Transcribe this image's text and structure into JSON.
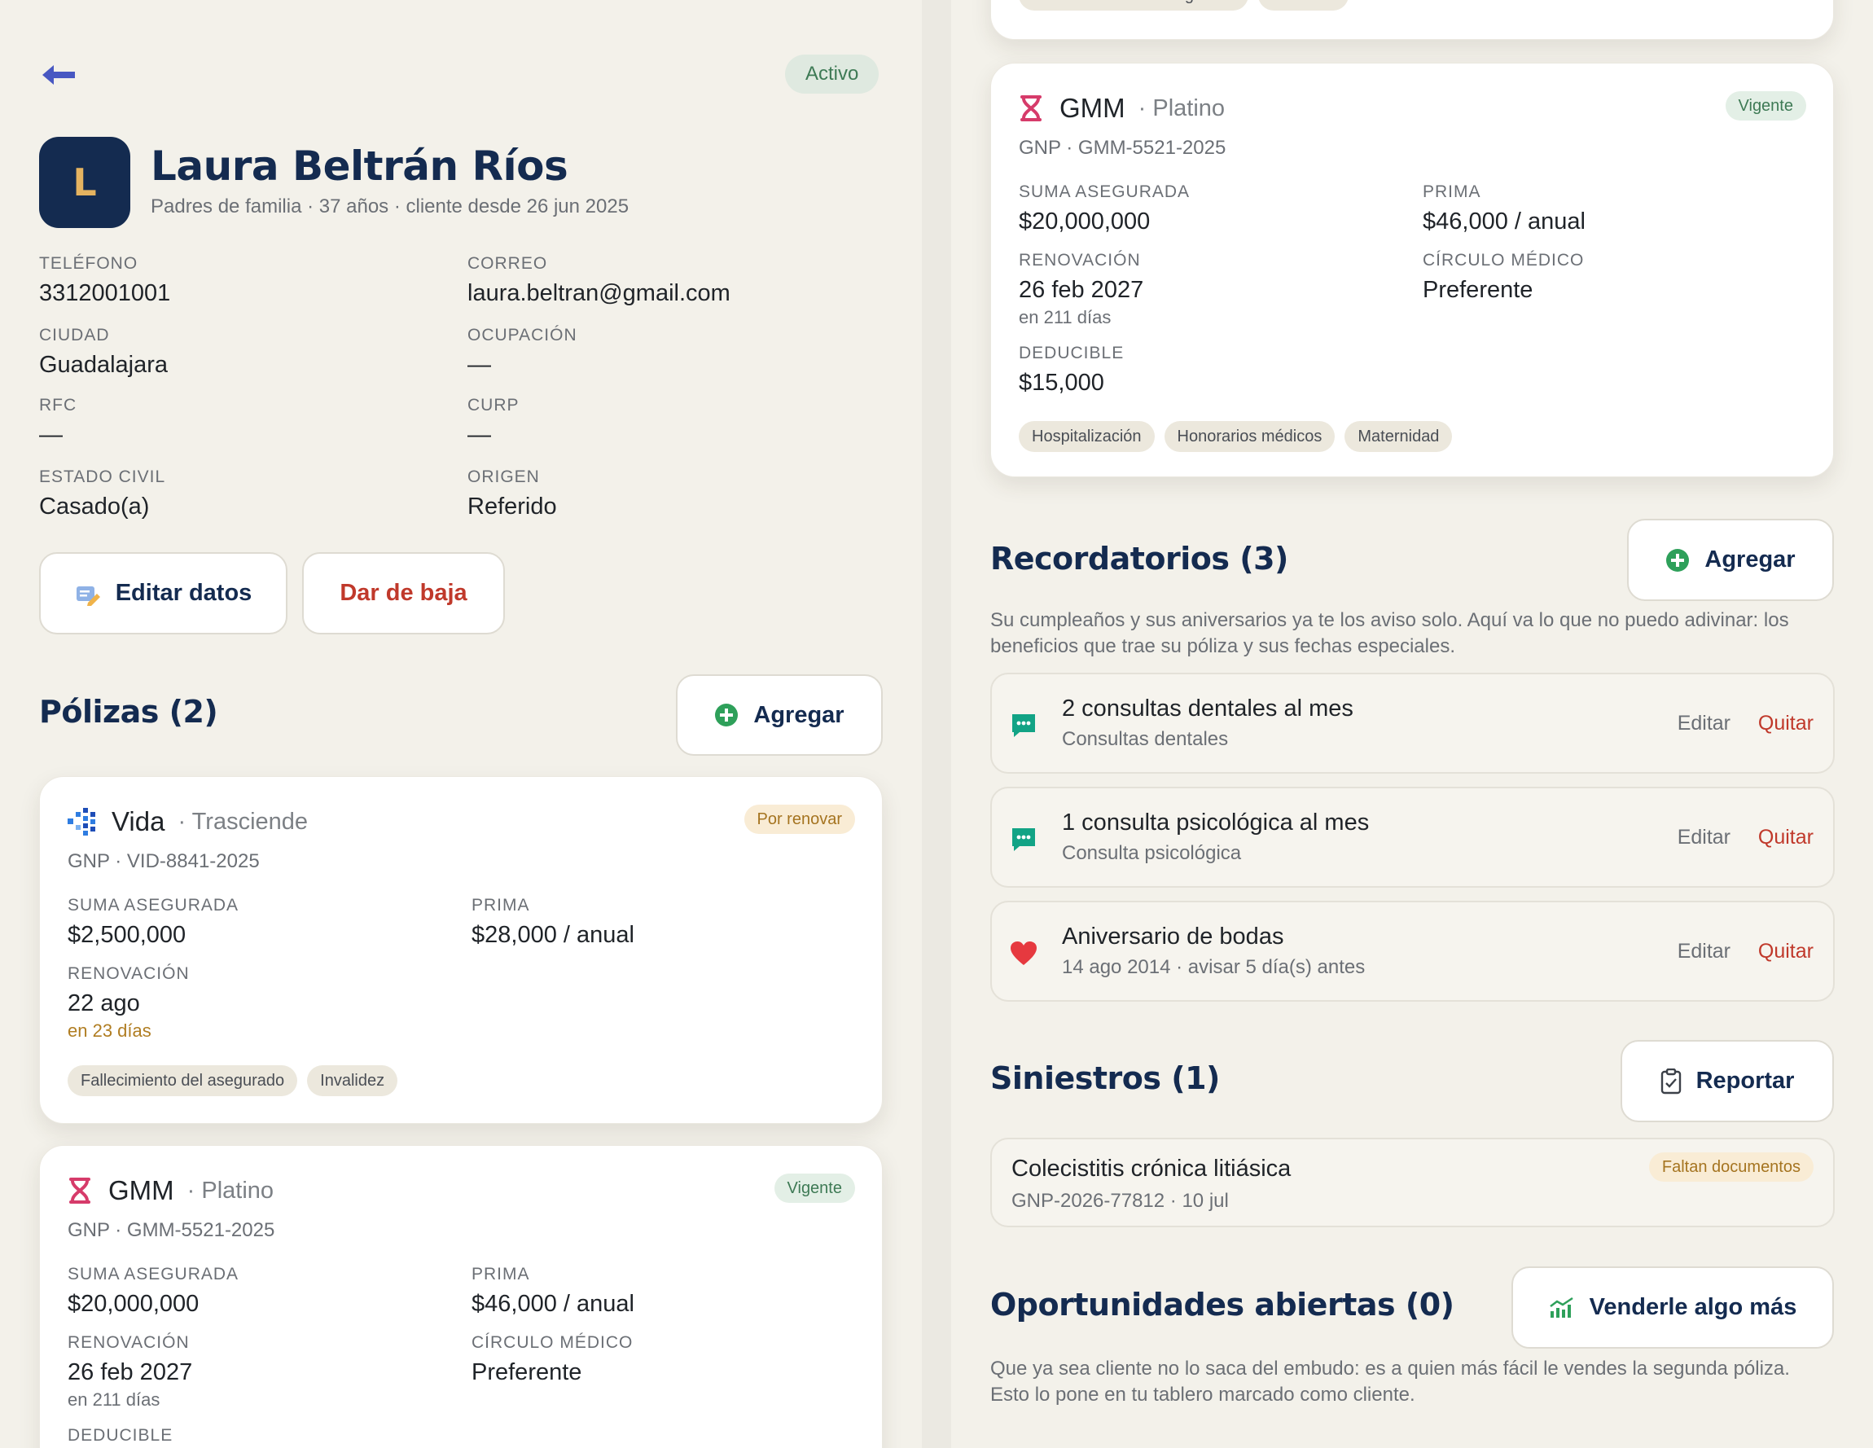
{
  "header": {
    "back_icon": "arrow-left-icon",
    "status": "Activo"
  },
  "client": {
    "initial": "L",
    "name": "Laura Beltrán Ríos",
    "subtitle": "Padres de familia · 37 años · cliente desde 26 jun 2025"
  },
  "fields": {
    "telefono": {
      "label": "TELÉFONO",
      "value": "3312001001"
    },
    "correo": {
      "label": "CORREO",
      "value": "laura.beltran@gmail.com"
    },
    "ciudad": {
      "label": "CIUDAD",
      "value": "Guadalajara"
    },
    "ocupacion": {
      "label": "OCUPACIÓN",
      "value": "—"
    },
    "rfc": {
      "label": "RFC",
      "value": "—"
    },
    "curp": {
      "label": "CURP",
      "value": "—"
    },
    "estado_civil": {
      "label": "ESTADO CIVIL",
      "value": "Casado(a)"
    },
    "origen": {
      "label": "ORIGEN",
      "value": "Referido"
    }
  },
  "actions": {
    "edit": "Editar datos",
    "deactivate": "Dar de baja"
  },
  "polizas": {
    "title": "Pólizas (2)",
    "add": "Agregar",
    "vida": {
      "icon": "life-dots-icon",
      "name": "Vida",
      "plan": "· Trasciende",
      "code": "GNP · VID-8841-2025",
      "status": "Por renovar",
      "suma_label": "SUMA ASEGURADA",
      "suma": "$2,500,000",
      "prima_label": "PRIMA",
      "prima": "$28,000 / anual",
      "renov_label": "RENOVACIÓN",
      "renov": "22 ago",
      "renov_note": "en 23 días",
      "tags": [
        "Fallecimiento del asegurado",
        "Invalidez"
      ]
    },
    "gmm": {
      "icon": "dna-icon",
      "name": "GMM",
      "plan": "· Platino",
      "code": "GNP · GMM-5521-2025",
      "status": "Vigente",
      "suma_label": "SUMA ASEGURADA",
      "suma": "$20,000,000",
      "prima_label": "PRIMA",
      "prima": "$46,000 / anual",
      "renov_label": "RENOVACIÓN",
      "renov": "26 feb 2027",
      "renov_note": "en 211 días",
      "circulo_label": "CÍRCULO MÉDICO",
      "circulo": "Preferente",
      "deducible_label": "DEDUCIBLE",
      "deducible": "$15,000",
      "tags": [
        "Hospitalización",
        "Honorarios médicos",
        "Maternidad"
      ]
    }
  },
  "recordatorios": {
    "title": "Recordatorios (3)",
    "add": "Agregar",
    "desc": "Su cumpleaños y sus aniversarios ya te los aviso solo. Aquí va lo que no puedo adivinar: los beneficios que trae su póliza y sus fechas especiales.",
    "edit": "Editar",
    "remove": "Quitar",
    "items": [
      {
        "icon": "chat-icon",
        "title": "2 consultas dentales al mes",
        "sub": "Consultas dentales"
      },
      {
        "icon": "chat-icon",
        "title": "1 consulta psicológica al mes",
        "sub": "Consulta psicológica"
      },
      {
        "icon": "heart-icon",
        "title": "Aniversario de bodas",
        "sub": "14 ago 2014 · avisar 5 día(s) antes"
      }
    ]
  },
  "siniestros": {
    "title": "Siniestros (1)",
    "report": "Reportar",
    "items": [
      {
        "title": "Colecistitis crónica litiásica",
        "sub": "GNP-2026-77812 · 10 jul",
        "status": "Faltan documentos"
      }
    ]
  },
  "oportunidades": {
    "title": "Oportunidades abiertas (0)",
    "sell": "Venderle algo más",
    "desc": "Que ya sea cliente no lo saca del embudo: es a quien más fácil le vendes la segunda póliza. Esto lo pone en tu tablero marcado como cliente."
  },
  "colors": {
    "navy": "#142b50",
    "gold": "#e5b360",
    "danger": "#c0392b",
    "green": "#3e7a55",
    "amber": "#a57420"
  }
}
